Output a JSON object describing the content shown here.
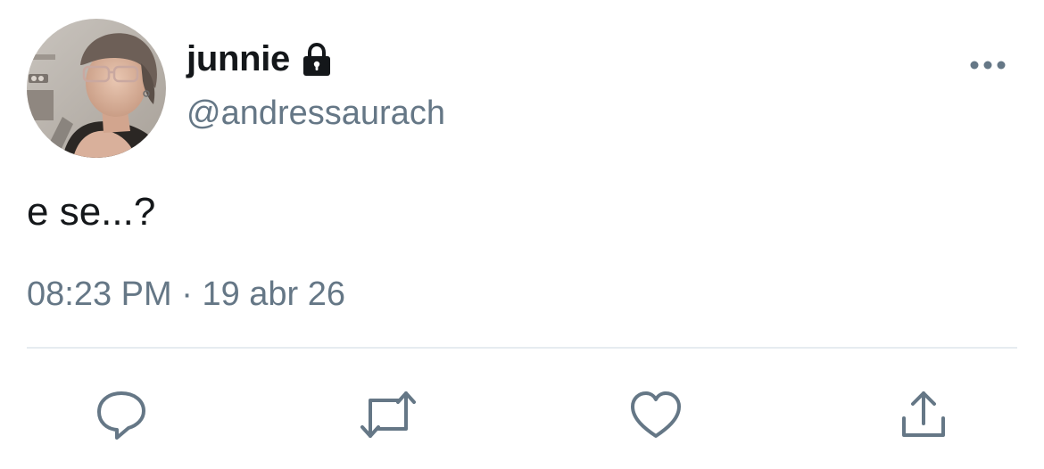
{
  "tweet": {
    "display_name": "junnie",
    "handle": "@andressaurach",
    "protected": true,
    "text": "e se...?",
    "time": "08:23 PM",
    "separator": "·",
    "date": "19 abr 26"
  },
  "icons": {
    "lock": "lock-icon",
    "more": "more-icon",
    "reply": "reply-icon",
    "retweet": "retweet-icon",
    "like": "like-icon",
    "share": "share-icon"
  },
  "colors": {
    "text": "#14171a",
    "secondary": "#657786",
    "divider": "#e6ecf0"
  }
}
